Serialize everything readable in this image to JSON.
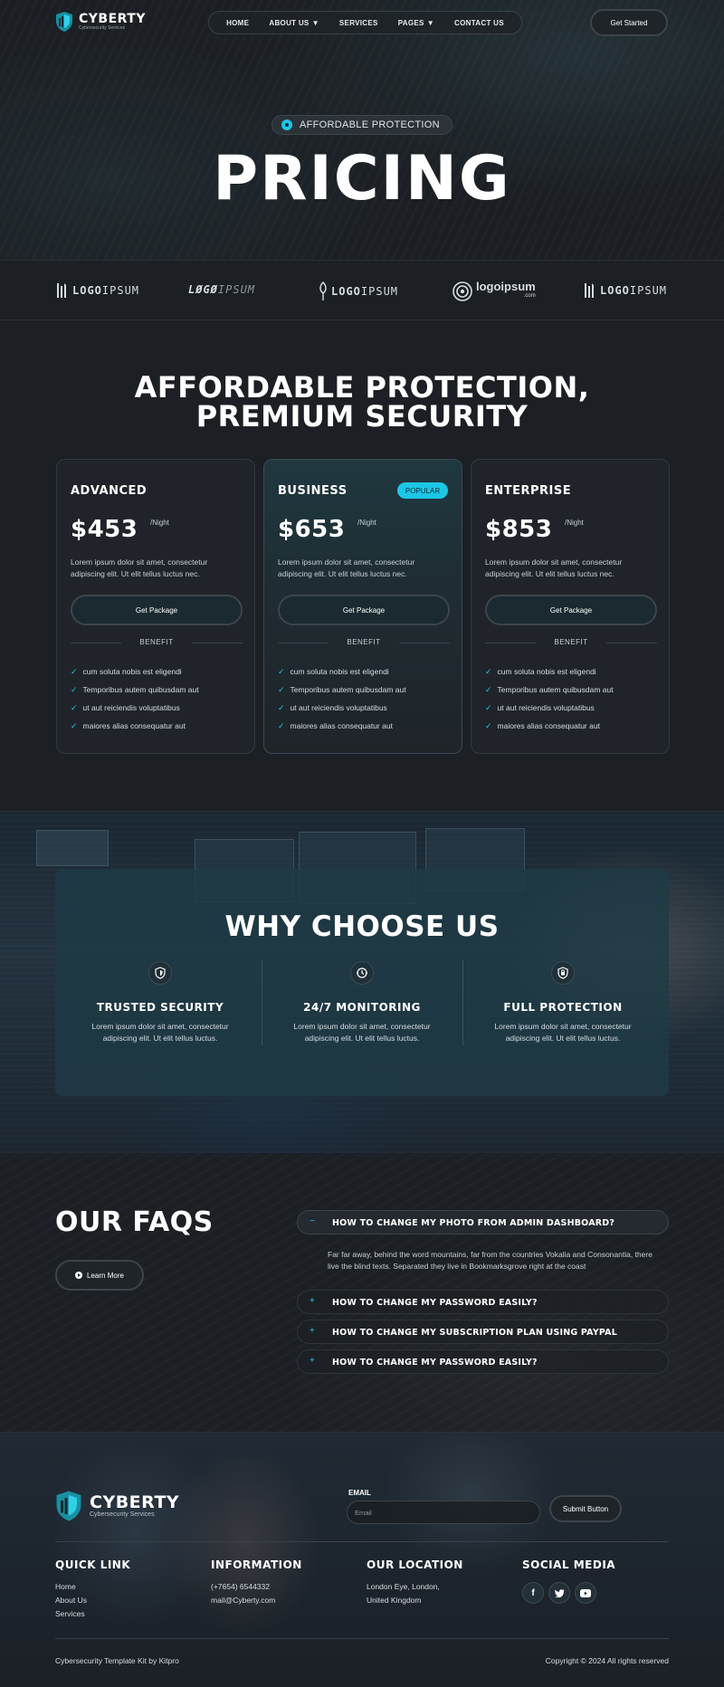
{
  "brand": {
    "name": "CYBERTY",
    "tagline": "Cybersecurity Services"
  },
  "nav": {
    "items": [
      {
        "label": "HOME",
        "has_dropdown": false
      },
      {
        "label": "ABOUT US",
        "has_dropdown": true
      },
      {
        "label": "SERVICES",
        "has_dropdown": false
      },
      {
        "label": "PAGES",
        "has_dropdown": true
      },
      {
        "label": "CONTACT US",
        "has_dropdown": false
      }
    ],
    "cta": "Get Started"
  },
  "hero": {
    "badge": "AFFORDABLE PROTECTION",
    "title": "PRICING"
  },
  "partner_logos": [
    {
      "text_a": "LOGO",
      "text_b": "IPSUM"
    },
    {
      "text_a": "LØGØ",
      "text_b": "IPSUM"
    },
    {
      "text_a": "LOGO",
      "text_b": "IPSUM"
    },
    {
      "text_a": "logoipsum",
      "text_b": ".com"
    },
    {
      "text_a": "LOGO",
      "text_b": "IPSUM"
    }
  ],
  "pricing": {
    "title_line1": "AFFORDABLE PROTECTION,",
    "title_line2": "PREMIUM SECURITY",
    "plans": [
      {
        "name": "ADVANCED",
        "badge": "",
        "price": "$453",
        "period": "/Night",
        "description": "Lorem ipsum dolor sit amet, consectetur adipiscing elit. Ut elit tellus luctus nec.",
        "cta": "Get Package",
        "benefit_label": "BENEFIT",
        "features": [
          "cum soluta nobis est eligendi",
          "Temporibus autem quibusdam aut",
          "ut aut reiciendis voluptatibus",
          "maiores alias consequatur aut"
        ]
      },
      {
        "name": "BUSINESS",
        "badge": "POPULAR",
        "price": "$653",
        "period": "/Night",
        "description": "Lorem ipsum dolor sit amet, consectetur adipiscing elit. Ut elit tellus luctus nec.",
        "cta": "Get Package",
        "benefit_label": "BENEFIT",
        "features": [
          "cum soluta nobis est eligendi",
          "Temporibus autem quibusdam aut",
          "ut aut reiciendis voluptatibus",
          "maiores alias consequatur aut"
        ]
      },
      {
        "name": "ENTERPRISE",
        "badge": "",
        "price": "$853",
        "period": "/Night",
        "description": "Lorem ipsum dolor sit amet, consectetur adipiscing elit. Ut elit tellus luctus nec.",
        "cta": "Get Package",
        "benefit_label": "BENEFIT",
        "features": [
          "cum soluta nobis est eligendi",
          "Temporibus autem quibusdam aut",
          "ut aut reiciendis voluptatibus",
          "maiores alias consequatur aut"
        ]
      }
    ]
  },
  "why": {
    "title": "WHY CHOOSE US",
    "features": [
      {
        "icon": "shield-icon",
        "title": "TRUSTED SECURITY",
        "text": "Lorem ipsum dolor sit amet, consectetur adipiscing elit. Ut elit tellus luctus."
      },
      {
        "icon": "monitoring-icon",
        "title": "24/7 MONITORING",
        "text": "Lorem ipsum dolor sit amet, consectetur adipiscing elit. Ut elit tellus luctus."
      },
      {
        "icon": "shield-lock-icon",
        "title": "FULL PROTECTION",
        "text": "Lorem ipsum dolor sit amet, consectetur adipiscing elit. Ut elit tellus luctus."
      }
    ]
  },
  "faq": {
    "title": "OUR FAQS",
    "cta": "Learn More",
    "items": [
      {
        "sign": "−",
        "question": "HOW TO CHANGE MY PHOTO FROM ADMIN DASHBOARD?",
        "answer": "Far far away, behind the word mountains, far from the countries Vokalia and Consonantia, there live the blind texts. Separated they live in Bookmarksgrove right at the coast",
        "open": true
      },
      {
        "sign": "+",
        "question": "HOW TO CHANGE MY PASSWORD EASILY?",
        "open": false
      },
      {
        "sign": "+",
        "question": "HOW TO CHANGE MY SUBSCRIPTION PLAN USING PAYPAL",
        "open": false
      },
      {
        "sign": "+",
        "question": "HOW TO CHANGE MY PASSWORD EASILY?",
        "open": false
      }
    ]
  },
  "footer": {
    "email_label": "EMAIL",
    "email_placeholder": "Email",
    "submit": "Submit Button",
    "columns": {
      "quick": {
        "title": "QUICK LINK",
        "links": [
          "Home",
          "About Us",
          "Services"
        ]
      },
      "info": {
        "title": "INFORMATION",
        "lines": [
          "(+7654) 6544332",
          "mail@Cyberty.com"
        ]
      },
      "location": {
        "title": "OUR LOCATION",
        "lines": [
          "London Eye, London,",
          "United Kingdom"
        ]
      },
      "social": {
        "title": "SOCIAL MEDIA",
        "icons": [
          "facebook-icon",
          "twitter-icon",
          "youtube-icon"
        ]
      }
    },
    "credit": "Cybersecurity Template Kit by Kitpro",
    "copyright": "Copyright © 2024 All rights reserved"
  },
  "colors": {
    "accent": "#1cc7e6",
    "background": "#1c1f24",
    "card": "#20242a"
  }
}
